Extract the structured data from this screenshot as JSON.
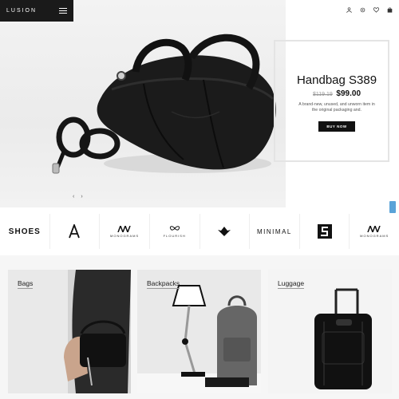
{
  "brand": {
    "logo": "LUSION"
  },
  "header": {
    "icons": [
      "user-icon",
      "settings-icon",
      "heart-icon",
      "bag-icon"
    ]
  },
  "hero": {
    "title": "Handbag S389",
    "old_price": "$119.19",
    "new_price": "$99.00",
    "description": "A brand-new, unused, and unworn item in the original packaging and.",
    "button": "BUY NOW",
    "prev": "‹",
    "next": "›"
  },
  "brands": [
    {
      "name": "SHOES",
      "sub": ""
    },
    {
      "name": "",
      "sub": ""
    },
    {
      "name": "",
      "sub": "MONOGRAMS"
    },
    {
      "name": "",
      "sub": "FLOURISH"
    },
    {
      "name": "",
      "sub": ""
    },
    {
      "name": "MINIMAL",
      "sub": ""
    },
    {
      "name": "",
      "sub": ""
    },
    {
      "name": "",
      "sub": "MONOGRAMS"
    }
  ],
  "categories": [
    {
      "label": "Bags"
    },
    {
      "label": "Backpacks"
    },
    {
      "label": "Luggage"
    }
  ],
  "colors": {
    "dark": "#1a1a1a",
    "accent_tab": "#5aa3d8"
  }
}
